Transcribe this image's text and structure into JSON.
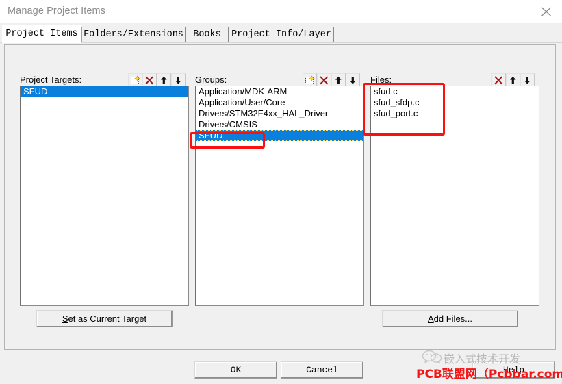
{
  "window": {
    "title": "Manage Project Items",
    "close_icon": "close-icon"
  },
  "tabs": [
    {
      "label": "Project Items",
      "active": true
    },
    {
      "label": "Folders/Extensions",
      "active": false
    },
    {
      "label": "Books",
      "active": false
    },
    {
      "label": "Project Info/Layer",
      "active": false
    }
  ],
  "panels": {
    "targets": {
      "label": "Project Targets:",
      "toolbar": [
        {
          "name": "new-item-icon",
          "title": "New (Insert)"
        },
        {
          "name": "delete-item-icon",
          "title": "Remove Item"
        },
        {
          "name": "move-up-icon",
          "title": "Move Up"
        },
        {
          "name": "move-down-icon",
          "title": "Move Down"
        }
      ],
      "items": [
        {
          "text": "SFUD",
          "selected": true
        }
      ]
    },
    "groups": {
      "label": "Groups:",
      "toolbar": [
        {
          "name": "new-item-icon",
          "title": "New (Insert)"
        },
        {
          "name": "delete-item-icon",
          "title": "Remove Item"
        },
        {
          "name": "move-up-icon",
          "title": "Move Up"
        },
        {
          "name": "move-down-icon",
          "title": "Move Down"
        }
      ],
      "items": [
        {
          "text": "Application/MDK-ARM",
          "selected": false
        },
        {
          "text": "Application/User/Core",
          "selected": false
        },
        {
          "text": "Drivers/STM32F4xx_HAL_Driver",
          "selected": false
        },
        {
          "text": "Drivers/CMSIS",
          "selected": false
        },
        {
          "text": "SFUD",
          "selected": true
        }
      ]
    },
    "files": {
      "label": "Files:",
      "toolbar": [
        {
          "name": "delete-item-icon",
          "title": "Remove Item"
        },
        {
          "name": "move-up-icon",
          "title": "Move Up"
        },
        {
          "name": "move-down-icon",
          "title": "Move Down"
        }
      ],
      "items": [
        {
          "text": "sfud.c",
          "selected": false
        },
        {
          "text": "sfud_sfdp.c",
          "selected": false
        },
        {
          "text": "sfud_port.c",
          "selected": false
        }
      ]
    }
  },
  "buttons": {
    "set_target": {
      "accel": "S",
      "rest": "et as Current Target"
    },
    "add_files": {
      "accel": "A",
      "rest": "dd Files..."
    },
    "ok": "OK",
    "cancel": "Cancel",
    "help": "Help"
  },
  "watermark": {
    "gray_text": "嵌入式技术开发",
    "red_text": "PCB联盟网（Pcbbar.com）",
    "logo": "wechat-logo-icon"
  },
  "colors": {
    "selection_blue": "#0a7fdc",
    "annotation_red": "#fb0f0f",
    "watermark_red": "#f41414",
    "dialog_face": "#f0f0f0",
    "title_gray": "#8d8d8d"
  }
}
